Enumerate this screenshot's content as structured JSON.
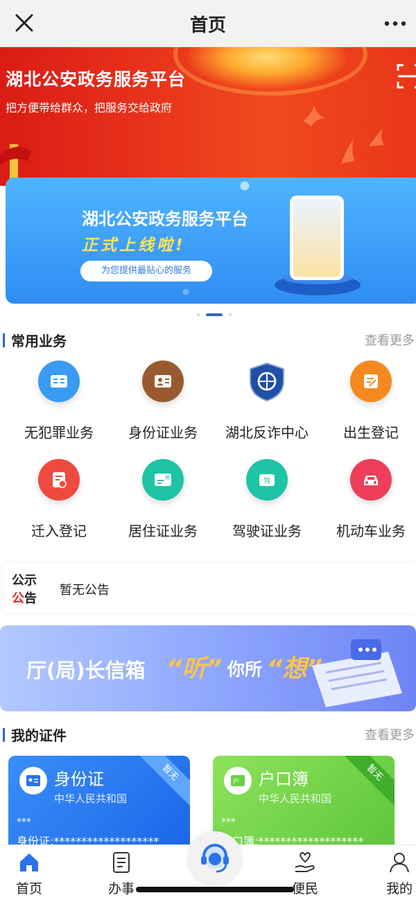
{
  "topbar": {
    "title": "首页"
  },
  "hero": {
    "title": "湖北公安政务服务平台",
    "subtitle": "把方便带给群众，把服务交给政府",
    "banner": {
      "line1": "湖北公安政务服务平台",
      "line2": "正式上线啦!",
      "pill": "为您提供最贴心的服务"
    }
  },
  "common": {
    "title": "常用业务",
    "more": "查看更多",
    "items": [
      {
        "label": "无犯罪业务",
        "icon": "id-card-icon",
        "color": "#3a9bf2"
      },
      {
        "label": "身份证业务",
        "icon": "person-card-icon",
        "color": "#9a5a2f"
      },
      {
        "label": "湖北反诈中心",
        "icon": "police-badge-icon",
        "color": "#1f4fa8"
      },
      {
        "label": "出生登记",
        "icon": "edit-doc-icon",
        "color": "#f5891f"
      },
      {
        "label": "迁入登记",
        "icon": "migrate-doc-icon",
        "color": "#ef4a3f"
      },
      {
        "label": "居住证业务",
        "icon": "residence-card-icon",
        "color": "#1fc3a5"
      },
      {
        "label": "驾驶证业务",
        "icon": "driver-license-icon",
        "color": "#1fc3a5"
      },
      {
        "label": "机动车业务",
        "icon": "car-icon",
        "color": "#ef3e5a"
      }
    ]
  },
  "notice": {
    "tag_line1": "公示",
    "tag_line2_red": "公",
    "tag_line2_dark": "告",
    "text": "暂无公告"
  },
  "mailbox": {
    "text1": "厅(局)长信箱",
    "text2": "“听”",
    "text3": "你所",
    "text4": "“想”"
  },
  "certs": {
    "title": "我的证件",
    "more": "查看更多",
    "cards": [
      {
        "name": "身份证",
        "sub": "中华人民共和国",
        "status": "***",
        "number": "身份证:*******************",
        "ribbon": "暂无"
      },
      {
        "name": "户口簿",
        "sub": "中华人民共和国",
        "status": "***",
        "number": "户口簿:*******************",
        "ribbon": "暂无"
      }
    ]
  },
  "tabbar": {
    "home": "首页",
    "affairs": "办事",
    "convenience": "便民",
    "mine": "我的"
  },
  "colors": {
    "accent": "#2f66d0",
    "hero_red": "#e8321c",
    "banner_blue": "#2f8df3",
    "notice_red": "#e2242c"
  }
}
